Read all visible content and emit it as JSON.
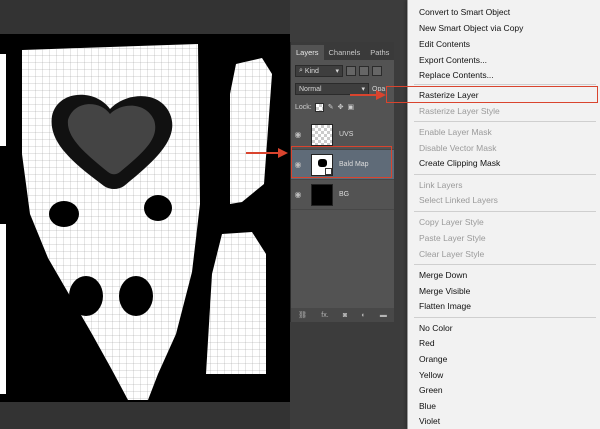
{
  "layers_panel": {
    "tabs": [
      "Layers",
      "Channels",
      "Paths"
    ],
    "kind_filter": "Kind",
    "blend_mode": "Normal",
    "opacity_label": "Opa",
    "lock_label": "Lock:",
    "layers": [
      {
        "name": "UVS",
        "visible": true
      },
      {
        "name": "Bald Map",
        "visible": true,
        "selected": true
      },
      {
        "name": "BG",
        "visible": true
      }
    ],
    "footer_icons": [
      "link-icon",
      "fx-icon",
      "mask-icon",
      "adjustment-icon",
      "folder-icon"
    ],
    "footer_fx": "fx."
  },
  "context_menu": {
    "items": [
      {
        "label": "Convert to Smart Object",
        "enabled": true
      },
      {
        "label": "New Smart Object via Copy",
        "enabled": true
      },
      {
        "label": "Edit Contents",
        "enabled": true
      },
      {
        "label": "Export Contents...",
        "enabled": true
      },
      {
        "label": "Replace Contents...",
        "enabled": true
      },
      {
        "label": "Rasterize Layer",
        "enabled": true,
        "highlighted": true
      },
      {
        "label": "Rasterize Layer Style",
        "enabled": false
      },
      {
        "label": "Enable Layer Mask",
        "enabled": false
      },
      {
        "label": "Disable Vector Mask",
        "enabled": false
      },
      {
        "label": "Create Clipping Mask",
        "enabled": true
      },
      {
        "label": "Link Layers",
        "enabled": false
      },
      {
        "label": "Select Linked Layers",
        "enabled": false
      },
      {
        "label": "Copy Layer Style",
        "enabled": false
      },
      {
        "label": "Paste Layer Style",
        "enabled": false
      },
      {
        "label": "Clear Layer Style",
        "enabled": false
      },
      {
        "label": "Merge Down",
        "enabled": true
      },
      {
        "label": "Merge Visible",
        "enabled": true
      },
      {
        "label": "Flatten Image",
        "enabled": true
      },
      {
        "label": "No Color",
        "enabled": true
      },
      {
        "label": "Red",
        "enabled": true
      },
      {
        "label": "Orange",
        "enabled": true
      },
      {
        "label": "Yellow",
        "enabled": true
      },
      {
        "label": "Green",
        "enabled": true
      },
      {
        "label": "Blue",
        "enabled": true
      },
      {
        "label": "Violet",
        "enabled": true
      }
    ]
  },
  "colors": {
    "annotation_red": "#d9442e",
    "menu_bg": "#f2f2f2",
    "panel_bg": "#535353"
  }
}
